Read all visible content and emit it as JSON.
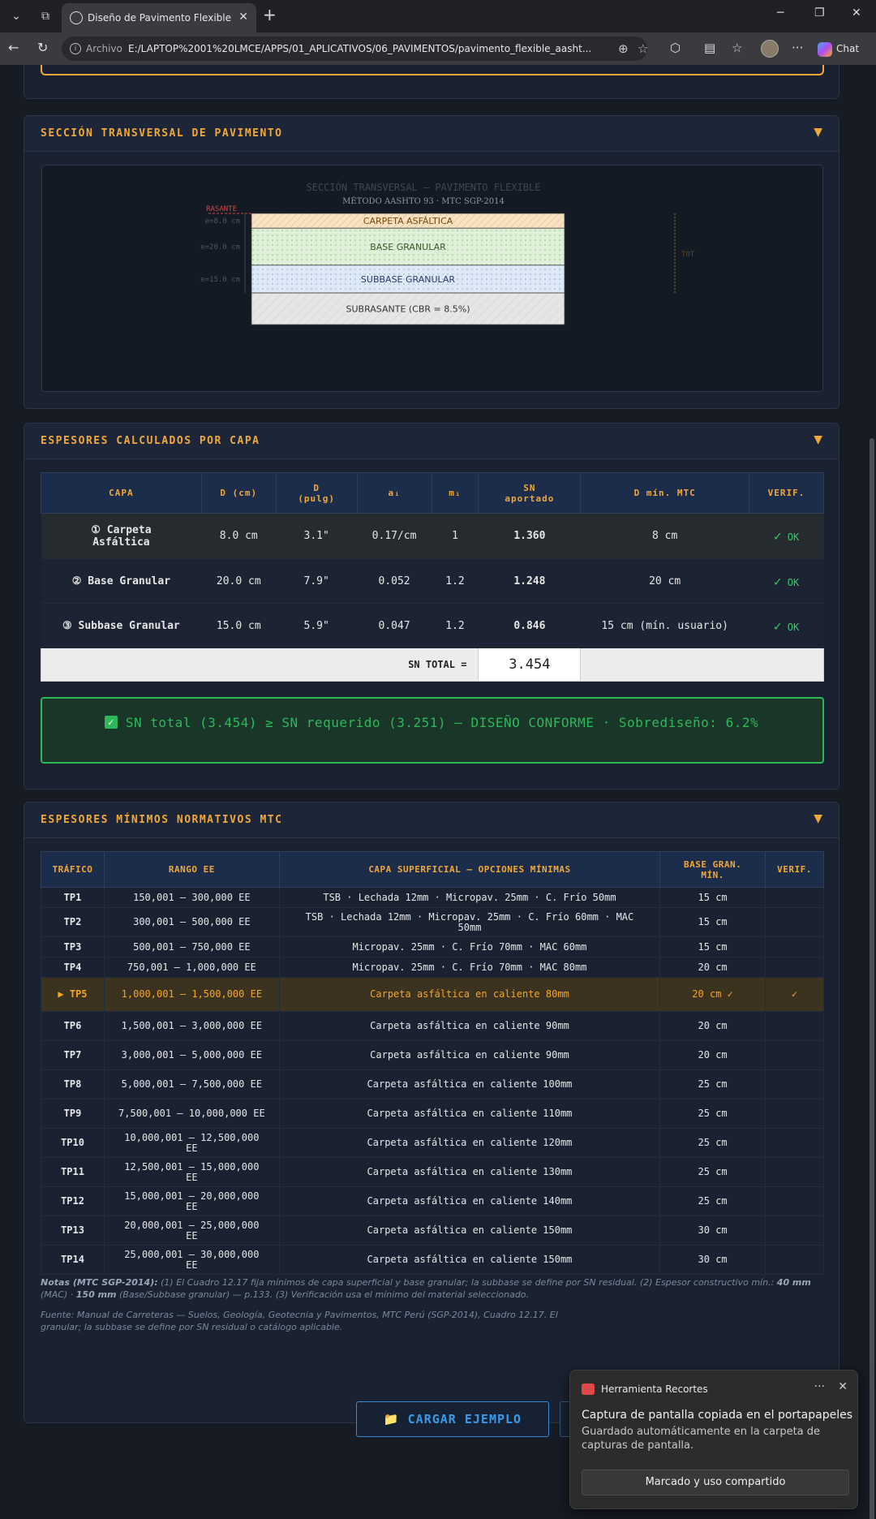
{
  "browser": {
    "tab_title": "Diseño de Pavimento Flexible — A",
    "address_prefix": "Archivo",
    "url": "E:/LAPTOP%2001%20LMCE/APPS/01_APLICATIVOS/06_PAVIMENTOS/pavimento_flexible_aasht...",
    "chat_label": "Chat"
  },
  "cross_section": {
    "header": "SECCIÓN TRANSVERSAL DE PAVIMENTO",
    "svg_title": "SECCIÓN TRANSVERSAL — PAVIMENTO FLEXIBLE",
    "svg_subtitle": "MÉTODO AASHTO 93 · MTC SGP-2014",
    "rasante": "RASANTE",
    "tot": "TOT",
    "layers": [
      {
        "label": "CARPETA ASFÁLTICA",
        "thickness_label": "e=8.0 cm",
        "cm": 8
      },
      {
        "label": "BASE GRANULAR",
        "thickness_label": "e=20.0 cm",
        "cm": 20
      },
      {
        "label": "SUBBASE GRANULAR",
        "thickness_label": "e=15.0 cm",
        "cm": 15
      },
      {
        "label": "SUBRASANTE (CBR = 8.5%)",
        "thickness_label": "",
        "cm": 0
      }
    ]
  },
  "thickness": {
    "header": "ESPESORES CALCULADOS POR CAPA",
    "columns": [
      "CAPA",
      "D (cm)",
      "D\n(pulg)",
      "aᵢ",
      "mᵢ",
      "SN\naportado",
      "D mín. MTC",
      "VERIF."
    ],
    "rows": [
      {
        "capa": "① Carpeta Asfáltica",
        "d_cm": "8.0 cm",
        "d_in": "3.1\"",
        "a": "0.17/cm",
        "m": "1",
        "sn": "1.360",
        "dmin": "8 cm",
        "verif": "OK"
      },
      {
        "capa": "② Base Granular",
        "d_cm": "20.0 cm",
        "d_in": "7.9\"",
        "a": "0.052",
        "m": "1.2",
        "sn": "1.248",
        "dmin": "20 cm",
        "verif": "OK"
      },
      {
        "capa": "③ Subbase Granular",
        "d_cm": "15.0 cm",
        "d_in": "5.9\"",
        "a": "0.047",
        "m": "1.2",
        "sn": "0.846",
        "dmin": "15 cm (mín. usuario)",
        "verif": "OK"
      }
    ],
    "total_label": "SN TOTAL =",
    "total_value": "3.454",
    "check_mark": "✓",
    "conformity": "SN total (3.454) ≥ SN requerido (3.251) — DISEÑO CONFORME · Sobrediseño: 6.2%"
  },
  "mtc": {
    "header": "ESPESORES MÍNIMOS NORMATIVOS MTC",
    "columns": [
      "TRÁFICO",
      "RANGO EE",
      "CAPA SUPERFICIAL — OPCIONES MÍNIMAS",
      "BASE GRAN.\nMÍN.",
      "VERIF."
    ],
    "rows": [
      {
        "tp": "TP1",
        "rango": "150,001 – 300,000 EE",
        "capa": "TSB · Lechada 12mm · Micropav. 25mm · C. Frío 50mm",
        "base": "15 cm",
        "verif": "",
        "sel": false
      },
      {
        "tp": "TP2",
        "rango": "300,001 – 500,000 EE",
        "capa": "TSB · Lechada 12mm · Micropav. 25mm · C. Frío 60mm · MAC 50mm",
        "base": "15 cm",
        "verif": "",
        "sel": false
      },
      {
        "tp": "TP3",
        "rango": "500,001 – 750,000 EE",
        "capa": "Micropav. 25mm · C. Frío 70mm · MAC 60mm",
        "base": "15 cm",
        "verif": "",
        "sel": false
      },
      {
        "tp": "TP4",
        "rango": "750,001 – 1,000,000 EE",
        "capa": "Micropav. 25mm · C. Frío 70mm · MAC 80mm",
        "base": "20 cm",
        "verif": "",
        "sel": false
      },
      {
        "tp": "▶ TP5",
        "rango": "1,000,001 – 1,500,000 EE",
        "capa": "Carpeta asfáltica en caliente 80mm",
        "base": "20 cm ✓",
        "verif": "✓",
        "sel": true
      },
      {
        "tp": "TP6",
        "rango": "1,500,001 – 3,000,000 EE",
        "capa": "Carpeta asfáltica en caliente 90mm",
        "base": "20 cm",
        "verif": "",
        "sel": false
      },
      {
        "tp": "TP7",
        "rango": "3,000,001 – 5,000,000 EE",
        "capa": "Carpeta asfáltica en caliente 90mm",
        "base": "20 cm",
        "verif": "",
        "sel": false
      },
      {
        "tp": "TP8",
        "rango": "5,000,001 – 7,500,000 EE",
        "capa": "Carpeta asfáltica en caliente 100mm",
        "base": "25 cm",
        "verif": "",
        "sel": false
      },
      {
        "tp": "TP9",
        "rango": "7,500,001 – 10,000,000 EE",
        "capa": "Carpeta asfáltica en caliente 110mm",
        "base": "25 cm",
        "verif": "",
        "sel": false
      },
      {
        "tp": "TP10",
        "rango": "10,000,001 – 12,500,000 EE",
        "capa": "Carpeta asfáltica en caliente 120mm",
        "base": "25 cm",
        "verif": "",
        "sel": false
      },
      {
        "tp": "TP11",
        "rango": "12,500,001 – 15,000,000 EE",
        "capa": "Carpeta asfáltica en caliente 130mm",
        "base": "25 cm",
        "verif": "",
        "sel": false
      },
      {
        "tp": "TP12",
        "rango": "15,000,001 – 20,000,000 EE",
        "capa": "Carpeta asfáltica en caliente 140mm",
        "base": "25 cm",
        "verif": "",
        "sel": false
      },
      {
        "tp": "TP13",
        "rango": "20,000,001 – 25,000,000 EE",
        "capa": "Carpeta asfáltica en caliente 150mm",
        "base": "30 cm",
        "verif": "",
        "sel": false
      },
      {
        "tp": "TP14",
        "rango": "25,000,001 – 30,000,000 EE",
        "capa": "Carpeta asfáltica en caliente 150mm",
        "base": "30 cm",
        "verif": "",
        "sel": false
      }
    ],
    "notes_label": "Notas (MTC SGP-2014):",
    "notes": " (1) El Cuadro 12.17 fija mínimos de capa superficial y base granular; la subbase se define por SN residual. (2) Espesor constructivo mín.: ",
    "notes_b1": "40 mm",
    "notes_mid": " (MAC) · ",
    "notes_b2": "150 mm",
    "notes_end": " (Base/Subbase granular) — p.133. (3) Verificación usa el mínimo del material seleccionado.",
    "source": "Fuente: Manual de Carreteras — Suelos, Geología, Geotecnia y Pavimentos, MTC Perú (SGP-2014), Cuadro 12.17. El\ngranular; la subbase se define por SN residual o catálogo aplicable."
  },
  "load_button": "CARGAR EJEMPLO",
  "toast": {
    "app": "Herramienta Recortes",
    "title": "Captura de pantalla copiada en el portapapeles",
    "body": "Guardado automáticamente en la carpeta de capturas de pantalla.",
    "button": "Marcado y uso compartido"
  }
}
